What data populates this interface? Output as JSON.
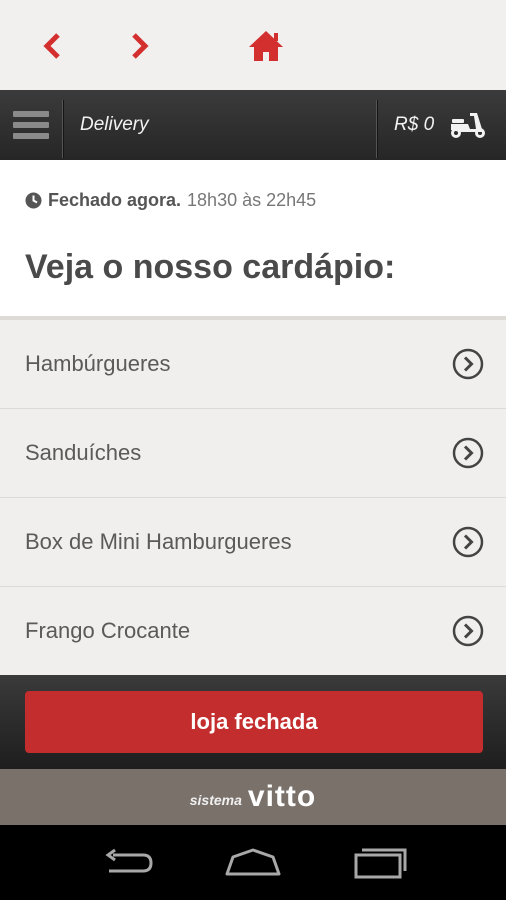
{
  "browser": {
    "back_icon": "chevron-left-icon",
    "forward_icon": "chevron-right-icon",
    "home_icon": "home-icon",
    "accent": "#d32f2f"
  },
  "header": {
    "menu_icon": "hamburger-menu-icon",
    "title": "Delivery",
    "cart_total": "R$ 0",
    "cart_icon": "scooter-icon"
  },
  "store": {
    "status": "Fechado agora.",
    "hours": "18h30 às 22h45",
    "heading": "Veja o nosso cardápio:"
  },
  "categories": [
    {
      "label": "Hambúrgueres"
    },
    {
      "label": "Sanduíches"
    },
    {
      "label": "Box de Mini Hamburgueres"
    },
    {
      "label": "Frango Crocante"
    }
  ],
  "action": {
    "label": "loja fechada",
    "color": "#c42d2d"
  },
  "brand": {
    "prefix": "sistema",
    "name": "vitto"
  },
  "system_nav": {
    "back_icon": "back-arrow-icon",
    "home_icon": "home-outline-icon",
    "recents_icon": "recent-apps-icon"
  }
}
